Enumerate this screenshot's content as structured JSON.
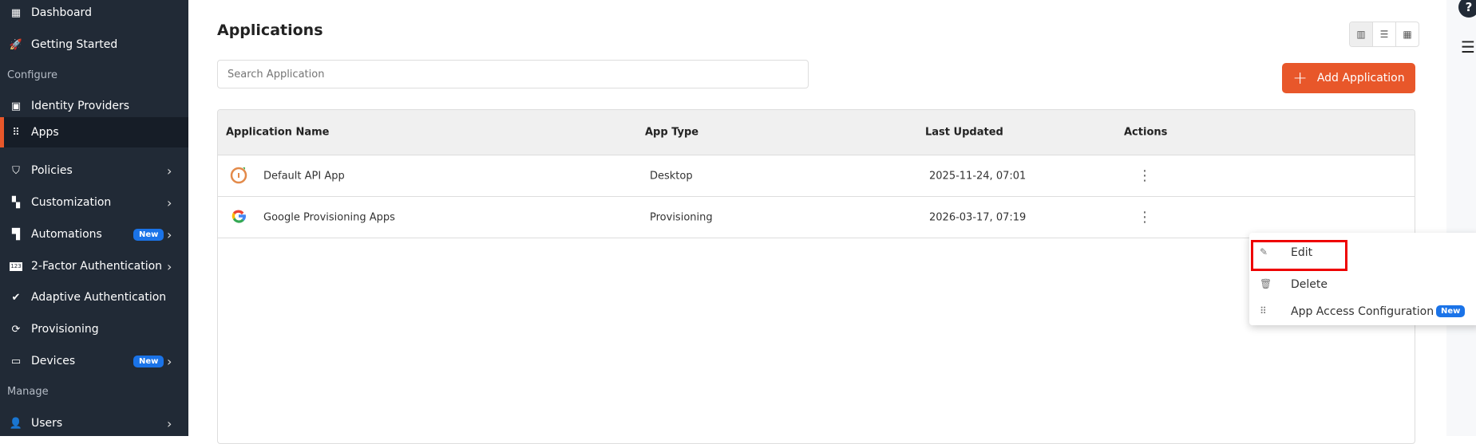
{
  "sidebar": {
    "items": [
      {
        "label": "Dashboard"
      },
      {
        "label": "Getting Started"
      },
      {
        "label": "Identity Providers"
      },
      {
        "label": "Apps"
      },
      {
        "label": "Policies"
      },
      {
        "label": "Customization"
      },
      {
        "label": "Automations",
        "badge": "New"
      },
      {
        "label": "2-Factor Authentication"
      },
      {
        "label": "Adaptive Authentication"
      },
      {
        "label": "Provisioning"
      },
      {
        "label": "Devices",
        "badge": "New"
      },
      {
        "label": "Users"
      }
    ],
    "sections": {
      "configure": "Configure",
      "manage": "Manage"
    }
  },
  "page": {
    "title": "Applications",
    "search_placeholder": "Search Application",
    "add_label": "Add Application"
  },
  "table": {
    "headers": [
      "Application Name",
      "App Type",
      "Last Updated",
      "Actions"
    ],
    "rows": [
      {
        "name": "Default API App",
        "type": "Desktop",
        "updated": "2025-11-24, 07:01"
      },
      {
        "name": "Google Provisioning Apps",
        "type": "Provisioning",
        "updated": "2026-03-17, 07:19"
      }
    ]
  },
  "menu": {
    "edit": "Edit",
    "delete": "Delete",
    "access": "App Access Configuration",
    "badge": "New"
  },
  "help": "?",
  "colors": {
    "accent": "#e8572a",
    "sidebar": "#212a36",
    "badge": "#1a73e8",
    "highlight": "#ee0000"
  }
}
